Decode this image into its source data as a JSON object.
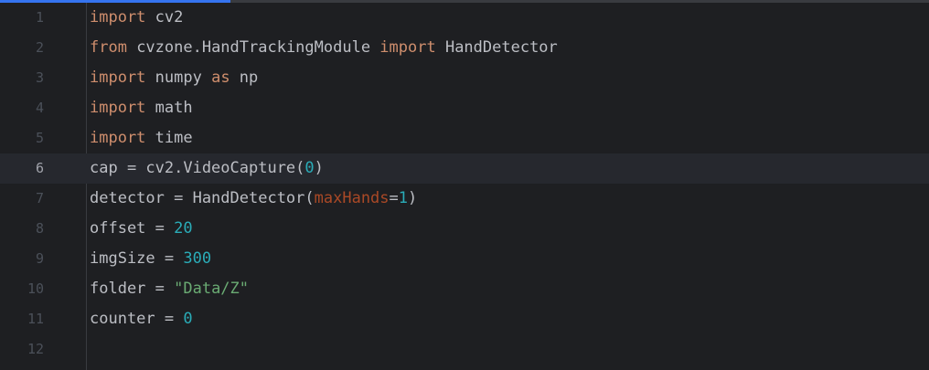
{
  "editor": {
    "lines": [
      {
        "number": "1",
        "tokens": [
          "import",
          " cv2"
        ]
      },
      {
        "number": "2",
        "tokens": [
          "from",
          " cvzone.HandTrackingModule ",
          "import",
          " HandDetector"
        ]
      },
      {
        "number": "3",
        "tokens": [
          "import",
          " numpy ",
          "as",
          " np"
        ]
      },
      {
        "number": "4",
        "tokens": [
          "import",
          " math"
        ]
      },
      {
        "number": "5",
        "tokens": [
          "import",
          " time"
        ]
      },
      {
        "number": "6",
        "tokens": [
          "cap = cv2.VideoCapture(",
          "0",
          ")"
        ]
      },
      {
        "number": "7",
        "tokens": [
          "detector = HandDetector(",
          "maxHands",
          "=",
          "1",
          ")"
        ]
      },
      {
        "number": "8",
        "tokens": [
          "offset = ",
          "20"
        ]
      },
      {
        "number": "9",
        "tokens": [
          "imgSize = ",
          "300"
        ]
      },
      {
        "number": "10",
        "tokens": [
          "folder = ",
          "\"Data/Z\""
        ]
      },
      {
        "number": "11",
        "tokens": [
          "counter = ",
          "0"
        ]
      },
      {
        "number": "12",
        "tokens": []
      }
    ],
    "current_line": 6,
    "colors": {
      "background": "#1e1f22",
      "keyword": "#cf8e6d",
      "number": "#2aacb8",
      "string": "#6aab73",
      "parameter": "#aa4926",
      "text": "#bcbec4"
    }
  }
}
